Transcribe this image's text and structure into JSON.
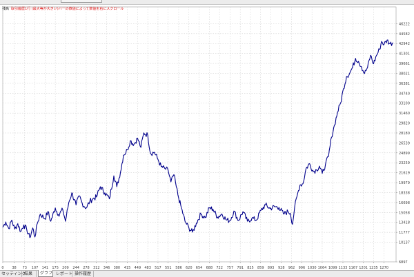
{
  "chart_title": {
    "label": "残高",
    "description": "取引履歴1行 (最大等が大きい)バーの数値によって数値を右にスクロール"
  },
  "tabs": [
    {
      "label": "セッティング",
      "active": false
    },
    {
      "label": "結果",
      "active": false
    },
    {
      "label": "グラフ",
      "active": true
    },
    {
      "label": "レポート",
      "active": false
    },
    {
      "label": "操作履歴",
      "active": false
    }
  ],
  "colors": {
    "line": "#00008b",
    "grid": "#c8c8c8",
    "axis_text": "#404040",
    "background": "#ffffff"
  },
  "chart_data": {
    "type": "line",
    "grid": true,
    "xlim": [
      0,
      1310
    ],
    "ylim": [
      6900,
      49000
    ],
    "x_ticks": [
      0,
      38,
      73,
      107,
      141,
      175,
      209,
      244,
      278,
      312,
      346,
      380,
      415,
      449,
      483,
      517,
      551,
      586,
      620,
      654,
      688,
      722,
      757,
      791,
      825,
      859,
      893,
      928,
      962,
      996,
      1030,
      1064,
      1099,
      1133,
      1167,
      1201,
      1235,
      1270
    ],
    "y_ticks": [
      6897,
      10137,
      11777,
      13418,
      15058,
      16698,
      18338,
      19979,
      21619,
      23259,
      24899,
      26539,
      28180,
      29820,
      31460,
      33100,
      34740,
      36381,
      38021,
      39661,
      41301,
      42942,
      44582,
      46222
    ],
    "series": [
      {
        "x": [
          0,
          10,
          20,
          30,
          40,
          50,
          60,
          70,
          80,
          90,
          100,
          107,
          115,
          125,
          141,
          150,
          160,
          175,
          185,
          200,
          209,
          220,
          230,
          244,
          255,
          265,
          278,
          290,
          300,
          312,
          325,
          340,
          355,
          370,
          380,
          392,
          402,
          415,
          425,
          437,
          449,
          460,
          470,
          483,
          492,
          505,
          517,
          528,
          540,
          551,
          560,
          570,
          578,
          586,
          595,
          607,
          620,
          632,
          645,
          660,
          675,
          688,
          700,
          715,
          730,
          745,
          757,
          770,
          785,
          800,
          815,
          830,
          845,
          860,
          875,
          890,
          905,
          920,
          935,
          950,
          958,
          965,
          972,
          980,
          990,
          1000,
          1010,
          1022,
          1035,
          1045,
          1055,
          1064,
          1075,
          1085,
          1095,
          1105,
          1115,
          1125,
          1135,
          1145,
          1155,
          1165,
          1175,
          1185,
          1195,
          1205,
          1215,
          1225,
          1235,
          1245,
          1255,
          1262,
          1270,
          1280,
          1290,
          1300
        ],
        "y": [
          12600,
          13500,
          12400,
          13800,
          12300,
          13200,
          11900,
          13000,
          12200,
          10900,
          12500,
          11000,
          13200,
          14800,
          14000,
          15200,
          13600,
          15800,
          14700,
          15500,
          13600,
          16700,
          18300,
          16300,
          17800,
          16500,
          15800,
          16900,
          17300,
          17600,
          19300,
          18300,
          17300,
          21100,
          19300,
          21700,
          24500,
          25400,
          26900,
          26300,
          27300,
          25800,
          28200,
          27800,
          24800,
          25000,
          23800,
          22600,
          22300,
          22000,
          20100,
          21300,
          19300,
          17400,
          15800,
          13600,
          12500,
          11800,
          13300,
          14800,
          14200,
          15800,
          15600,
          14300,
          14800,
          13800,
          13700,
          15300,
          13700,
          15200,
          13600,
          14100,
          13800,
          15400,
          16300,
          15700,
          16000,
          15900,
          14800,
          15200,
          14900,
          13100,
          15800,
          17700,
          19600,
          19800,
          22300,
          23100,
          21800,
          22100,
          22700,
          21500,
          23000,
          24300,
          27500,
          29500,
          31600,
          33100,
          35500,
          37500,
          38000,
          39000,
          40500,
          40000,
          39100,
          38000,
          39000,
          41000,
          39600,
          41000,
          42000,
          43300,
          42800,
          43500,
          42900,
          43100
        ]
      }
    ]
  }
}
